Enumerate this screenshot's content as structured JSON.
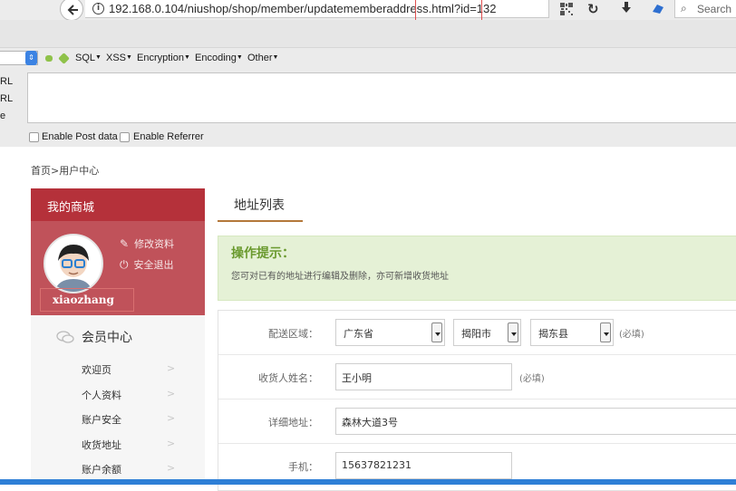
{
  "browser": {
    "url": "192.168.0.104/niushop/shop/member/updatememberaddress.html?id=132",
    "search_placeholder": "Search"
  },
  "hackbar": {
    "menus": [
      "SQL",
      "XSS",
      "Encryption",
      "Encoding",
      "Other"
    ],
    "side_labels": [
      "RL",
      "RL",
      "e"
    ],
    "enable_post": "Enable Post data",
    "enable_referrer": "Enable Referrer"
  },
  "page": {
    "breadcrumb": "首页>用户中心",
    "sidebar": {
      "title": "我的商城",
      "edit_profile": "修改资料",
      "logout": "安全退出",
      "username": "xiaozhang",
      "member_center": "会员中心",
      "items": [
        "欢迎页",
        "个人资料",
        "账户安全",
        "收货地址",
        "账户余额"
      ]
    },
    "tab_label": "地址列表",
    "tip": {
      "title": "操作提示：",
      "description": "您可对已有的地址进行编辑及删除，亦可新增收货地址"
    },
    "form": {
      "region_label": "配送区域：",
      "province": "广东省",
      "city": "揭阳市",
      "district": "揭东县",
      "required": "(必填)",
      "name_label": "收货人姓名：",
      "name_value": "王小明",
      "address_label": "详细地址：",
      "address_value": "森林大道3号",
      "phone_label": "手机：",
      "phone_value": "15637821231"
    }
  }
}
